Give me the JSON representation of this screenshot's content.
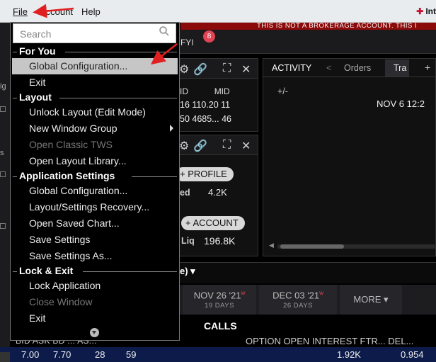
{
  "menubar": {
    "file": "File",
    "account": "Account",
    "help": "Help",
    "brand": "Int"
  },
  "warning": "THIS IS NOT A BROKERAGE ACCOUNT. THIS I",
  "toolbar": {
    "fyi": "FYI",
    "fyi_badge": "8"
  },
  "quote": {
    "header_bid": "ID",
    "header_mid": "MID",
    "row1": "16  110.20  11",
    "row2": "50  4685...  46"
  },
  "account": {
    "profile_label": "+ PROFILE",
    "label1": "ed",
    "value1": "4.2K",
    "account_label": "+ ACCOUNT",
    "label2": "Liq",
    "value2": "196.8K"
  },
  "activity": {
    "tabs": {
      "activity": "ACTIVITY",
      "orders": "Orders",
      "trades": "Tra",
      "add": "+"
    },
    "pm": "+/-",
    "date": "NOV 6 12:2"
  },
  "chain": {
    "title": "e) ▾",
    "expirations": [
      {
        "date": "NOV 26 '21",
        "flag": "w",
        "days": "19 DAYS"
      },
      {
        "date": "DEC 03 '21",
        "flag": "w",
        "days": "26 DAYS"
      }
    ],
    "more": "MORE ▾",
    "calls": "CALLS",
    "col_headers_left": "BID    ASK  BD ...  AS...",
    "col_headers_right": "OPTION OPEN INTEREST FTR... DEL...",
    "row": {
      "bid": "7.00",
      "ask": "7.70",
      "bd": "28",
      "as": "59",
      "oi": "1.92K",
      "del": "0.954"
    }
  },
  "leftstrip": {
    "g": "ig",
    "s": "s"
  },
  "menu": {
    "search_placeholder": "Search",
    "sections": {
      "for_you": "For You",
      "layout": "Layout",
      "app_settings": "Application Settings",
      "lock_exit": "Lock & Exit"
    },
    "items": {
      "global_config_fav": "Global Configuration...",
      "exit_fav": "Exit",
      "unlock_layout": "Unlock Layout (Edit Mode)",
      "new_window_group": "New Window Group",
      "open_classic_tws": "Open Classic TWS",
      "open_layout_library": "Open Layout Library...",
      "global_config": "Global Configuration...",
      "layout_recovery": "Layout/Settings Recovery...",
      "open_saved_chart": "Open Saved Chart...",
      "save_settings": "Save Settings",
      "save_settings_as": "Save Settings As...",
      "lock_application": "Lock Application",
      "close_window": "Close Window",
      "exit": "Exit"
    }
  },
  "colors": {
    "menu_bg": "#000000",
    "highlight": "#c6c6c6",
    "annotation": "#e02020",
    "warning_strip": "#8b0a0a",
    "badge": "#e24454"
  }
}
